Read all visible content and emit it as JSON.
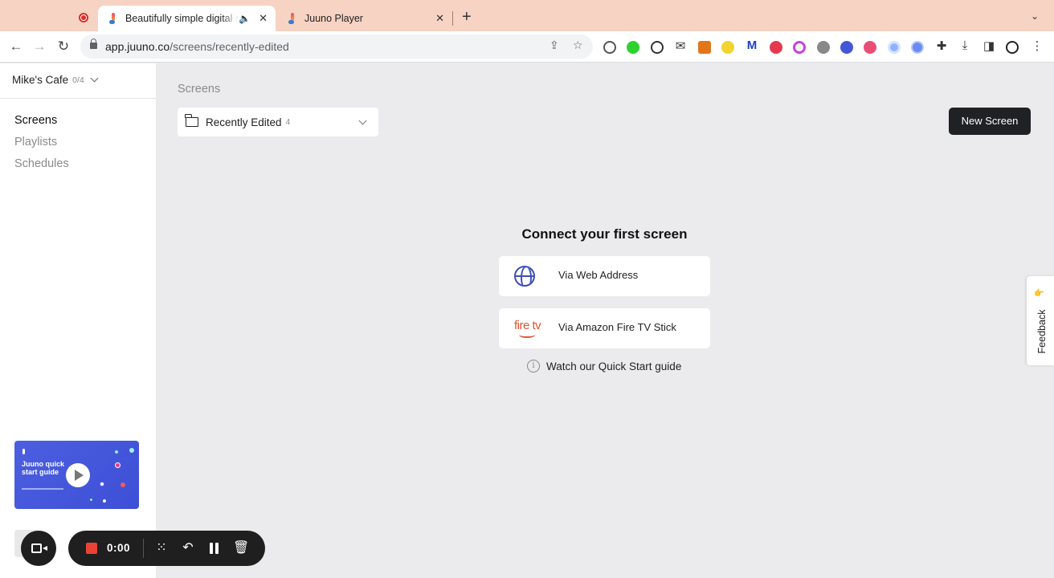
{
  "browser": {
    "tabs": [
      {
        "title": "Beautifully simple digital signage",
        "active": true
      },
      {
        "title": "Juuno Player",
        "active": false
      }
    ],
    "url_host": "app.juuno.co",
    "url_path": "/screens/recently-edited"
  },
  "sidebar": {
    "workspace_name": "Mike's Cafe",
    "workspace_count": "0/4",
    "nav": [
      {
        "label": "Screens",
        "active": true
      },
      {
        "label": "Playlists",
        "active": false
      },
      {
        "label": "Schedules",
        "active": false
      }
    ],
    "guide_card": {
      "text": "Juuno quick start guide"
    }
  },
  "main": {
    "breadcrumb": "Screens",
    "folder_select": {
      "label": "Recently Edited",
      "count": "4"
    },
    "new_screen_label": "New Screen",
    "empty_state": {
      "heading": "Connect your first screen",
      "options": [
        {
          "label": "Via Web Address",
          "icon": "globe-icon"
        },
        {
          "label": "Via Amazon Fire TV Stick",
          "icon": "firetv-logo"
        }
      ],
      "guide_link": "Watch our Quick Start guide"
    }
  },
  "feedback": {
    "label": "Feedback"
  },
  "recorder": {
    "timer": "0:00"
  },
  "colors": {
    "accent": "#3d4fd6",
    "button_dark": "#1f2125",
    "record_red": "#ea4335",
    "tab_strip": "#f6d3c3"
  }
}
